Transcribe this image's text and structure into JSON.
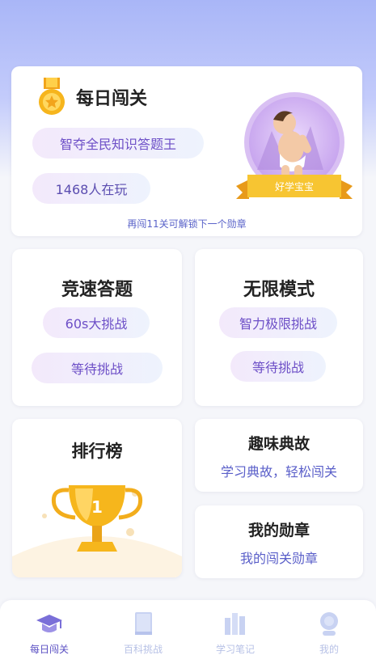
{
  "hero": {
    "title": "每日闯关",
    "pill1": "智夺全民知识答题王",
    "pill2": "1468人在玩",
    "hint": "再闯11关可解锁下一个勋章",
    "badge_label": "好学宝宝"
  },
  "speed": {
    "title": "竞速答题",
    "btn1": "60s大挑战",
    "btn2": "等待挑战"
  },
  "endless": {
    "title": "无限模式",
    "btn1": "智力极限挑战",
    "btn2": "等待挑战"
  },
  "rank": {
    "title": "排行榜"
  },
  "story": {
    "title": "趣味典故",
    "subtitle": "学习典故，轻松闯关"
  },
  "medals": {
    "title": "我的勋章",
    "subtitle": "我的闯关勋章"
  },
  "tabs": [
    {
      "label": "每日闯关",
      "icon": "graduation-cap-icon",
      "active": true
    },
    {
      "label": "百科挑战",
      "icon": "book-icon",
      "active": false
    },
    {
      "label": "学习笔记",
      "icon": "notes-icon",
      "active": false
    },
    {
      "label": "我的",
      "icon": "user-icon",
      "active": false
    }
  ],
  "colors": {
    "accent": "#5a4fc3",
    "pill_text": "#6d4fc7",
    "gold": "#f5b81c"
  }
}
